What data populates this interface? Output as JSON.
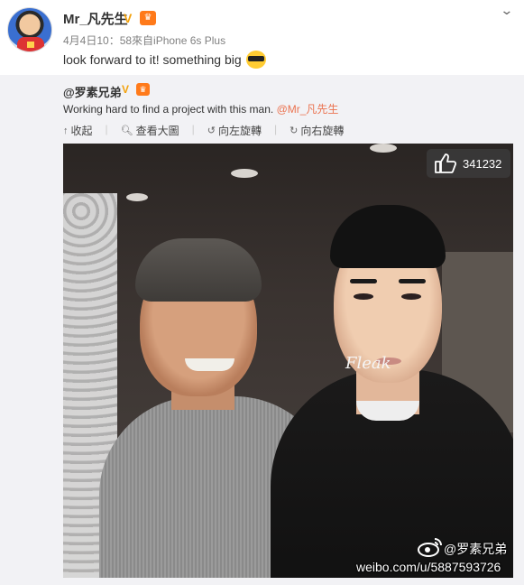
{
  "post": {
    "username": "Mr_凡先生",
    "verified_badge": "V",
    "meta": "4月4日10：58來自iPhone 6s Plus",
    "text": "look forward to it! something big",
    "emoji": "cool-sunglasses"
  },
  "repost": {
    "username": "@罗素兄弟",
    "verified_badge": "V",
    "text": "Working hard to find a project with this man.",
    "mention": "@Mr_凡先生"
  },
  "actions": {
    "collapse": "收起",
    "view_large": "查看大圖",
    "rotate_left": "向左旋轉",
    "rotate_right": "向右旋轉"
  },
  "photo": {
    "like_count": "341232",
    "shirt_text": "Fleak",
    "watermark_handle": "@罗素兄弟",
    "watermark_url": "weibo.com/u/5887593726"
  },
  "colors": {
    "link": "#eb7350",
    "vip": "#f3a20d",
    "repost_bg": "#f2f2f5"
  }
}
